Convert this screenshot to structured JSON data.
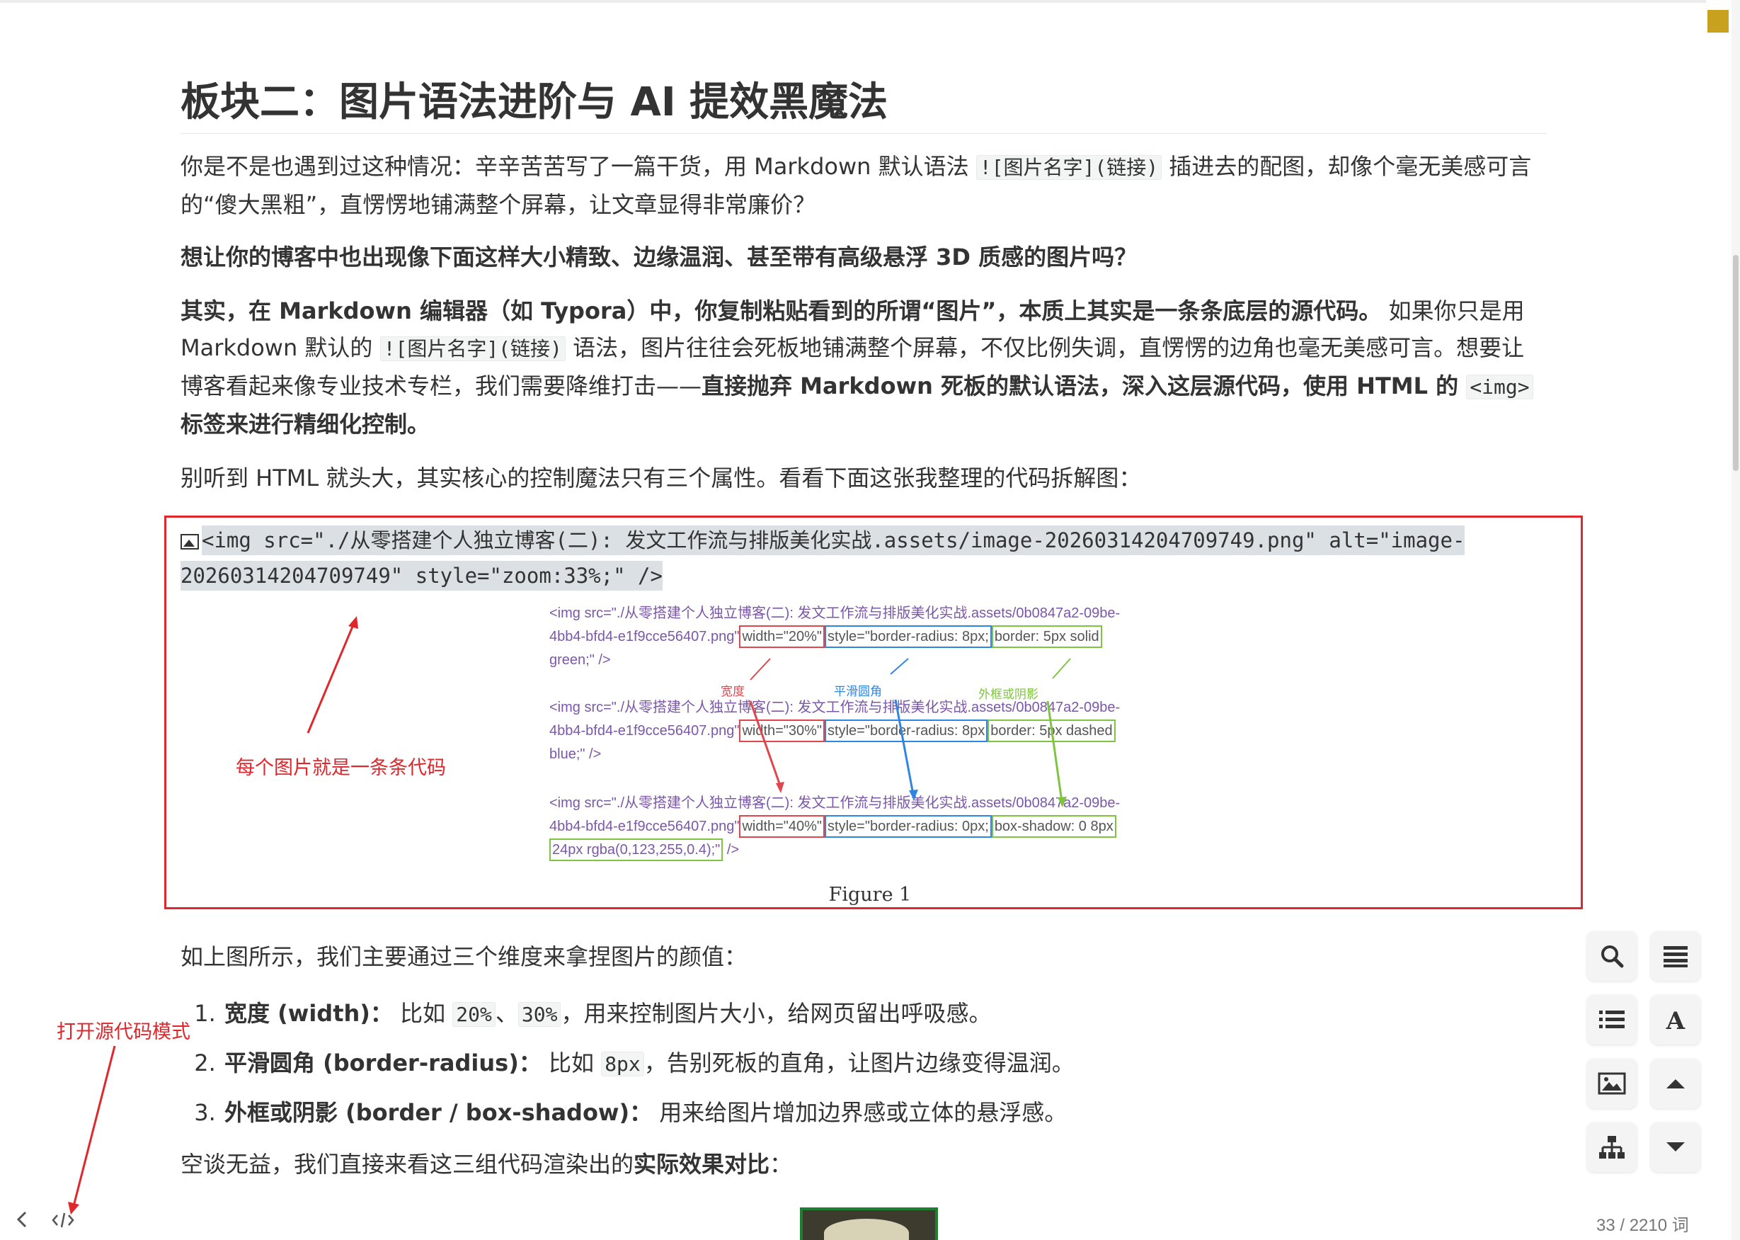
{
  "heading": "板块二：图片语法进阶与 AI 提效黑魔法",
  "p1": {
    "t1": "你是不是也遇到过这种情况：辛辛苦苦写了一篇干货，用 Markdown 默认语法 ",
    "code": "![图片名字](链接)",
    "t2": " 插进去的配图，却像个毫无美感可言的“傻大黑粗”，直愣愣地铺满整个屏幕，让文章显得非常廉价？"
  },
  "p2": "想让你的博客中也出现像下面这样大小精致、边缘温润、甚至带有高级悬浮 3D 质感的图片吗？",
  "p3": {
    "b1": "其实，在 Markdown 编辑器（如 Typora）中，你复制粘贴看到的所谓“图片”，本质上其实是一条条底层的源代码。",
    "t1": " 如果你只是用 Markdown 默认的 ",
    "code1": "![图片名字](链接)",
    "t2": " 语法，图片往往会死板地铺满整个屏幕，不仅比例失调，直愣愣的边角也毫无美感可言。想要让博客看起来像专业技术专栏，我们需要降维打击——",
    "b2": "直接抛弃 Markdown 死板的默认语法，深入这层源代码，使用 HTML 的 ",
    "code2": "<img>",
    "b3": " 标签来进行精细化控制。"
  },
  "p4": "别听到 HTML 就头大，其实核心的控制魔法只有三个属性。看看下面这张我整理的代码拆解图：",
  "source_code": "<img src=\"./从零搭建个人独立博客(二): 发文工作流与排版美化实战.assets/image-20260314204709749.png\" alt=\"image-20260314204709749\" style=\"zoom:33%;\" />",
  "figure": {
    "block1": {
      "line1": "<img src=\"./从零搭建个人独立博客(二): 发文工作流与排版美化实战.assets/0b0847a2-09be-",
      "line2_pre": "4bb4-bfd4-e1f9cce56407.png\"",
      "width": "width=\"20%\"",
      "style": "style=\"border-radius: 8px;",
      "border": "border: 5px solid",
      "line3": "green;\" />"
    },
    "block2": {
      "line1": "<img src=\"./从零搭建个人独立博客(二): 发文工作流与排版美化实战.assets/0b0847a2-09be-",
      "line2_pre": "4bb4-bfd4-e1f9cce56407.png\"",
      "width": "width=\"30%\"",
      "style": "style=\"border-radius: 8px",
      "border": "border: 5px dashed",
      "line3": "blue;\" />"
    },
    "block3": {
      "line1": "<img src=\"./从零搭建个人独立博客(二): 发文工作流与排版美化实战.assets/0b0847a2-09be-",
      "line2_pre": "4bb4-bfd4-e1f9cce56407.png\"",
      "width": "width=\"40%\"",
      "style": "style=\"border-radius: 0px;",
      "border": "box-shadow: 0 8px",
      "line3_box": "24px rgba(0,123,255,0.4);\"",
      "line3_end": " />"
    },
    "label_width": "宽度",
    "label_radius": "平滑圆角",
    "label_border": "外框或阴影",
    "caption": "Figure 1"
  },
  "annotation_left": "每个图片就是一条条代码",
  "annotation_source_mode": "打开源代码模式",
  "p5": "如上图所示，我们主要通过三个维度来拿捏图片的颜值：",
  "list": [
    {
      "num": "1.",
      "bold": "宽度 (width)：",
      "t1": " 比如 ",
      "c1": "20%",
      "sep": "、",
      "c2": "30%",
      "t2": "，用来控制图片大小，给网页留出呼吸感。"
    },
    {
      "num": "2.",
      "bold": "平滑圆角 (border-radius)：",
      "t1": " 比如 ",
      "c1": "8px",
      "t2": "，告别死板的直角，让图片边缘变得温润。"
    },
    {
      "num": "3.",
      "bold": "外框或阴影 (border / box-shadow)：",
      "t1": " 用来给图片增加边界感或立体的悬浮感。"
    }
  ],
  "p6": {
    "t1": "空谈无益，我们直接来看这三组代码渲染出的",
    "b1": "实际效果对比",
    "t2": "："
  },
  "word_count": "33 / 2210 词",
  "colors": {
    "annotation_red": "#e0272c",
    "box_blue": "#2f86e2",
    "box_green": "#7ec441",
    "accent_gold": "#c8a11f",
    "code_highlight": "#dbe0e5"
  },
  "icons": {
    "search": "search-icon",
    "outline": "outline-icon",
    "list": "list-icon",
    "font": "font-icon",
    "image": "image-icon",
    "up": "arrow-up-icon",
    "tree": "sitemap-icon",
    "down": "arrow-down-icon",
    "back": "chevron-left-icon",
    "source": "source-code-icon"
  }
}
